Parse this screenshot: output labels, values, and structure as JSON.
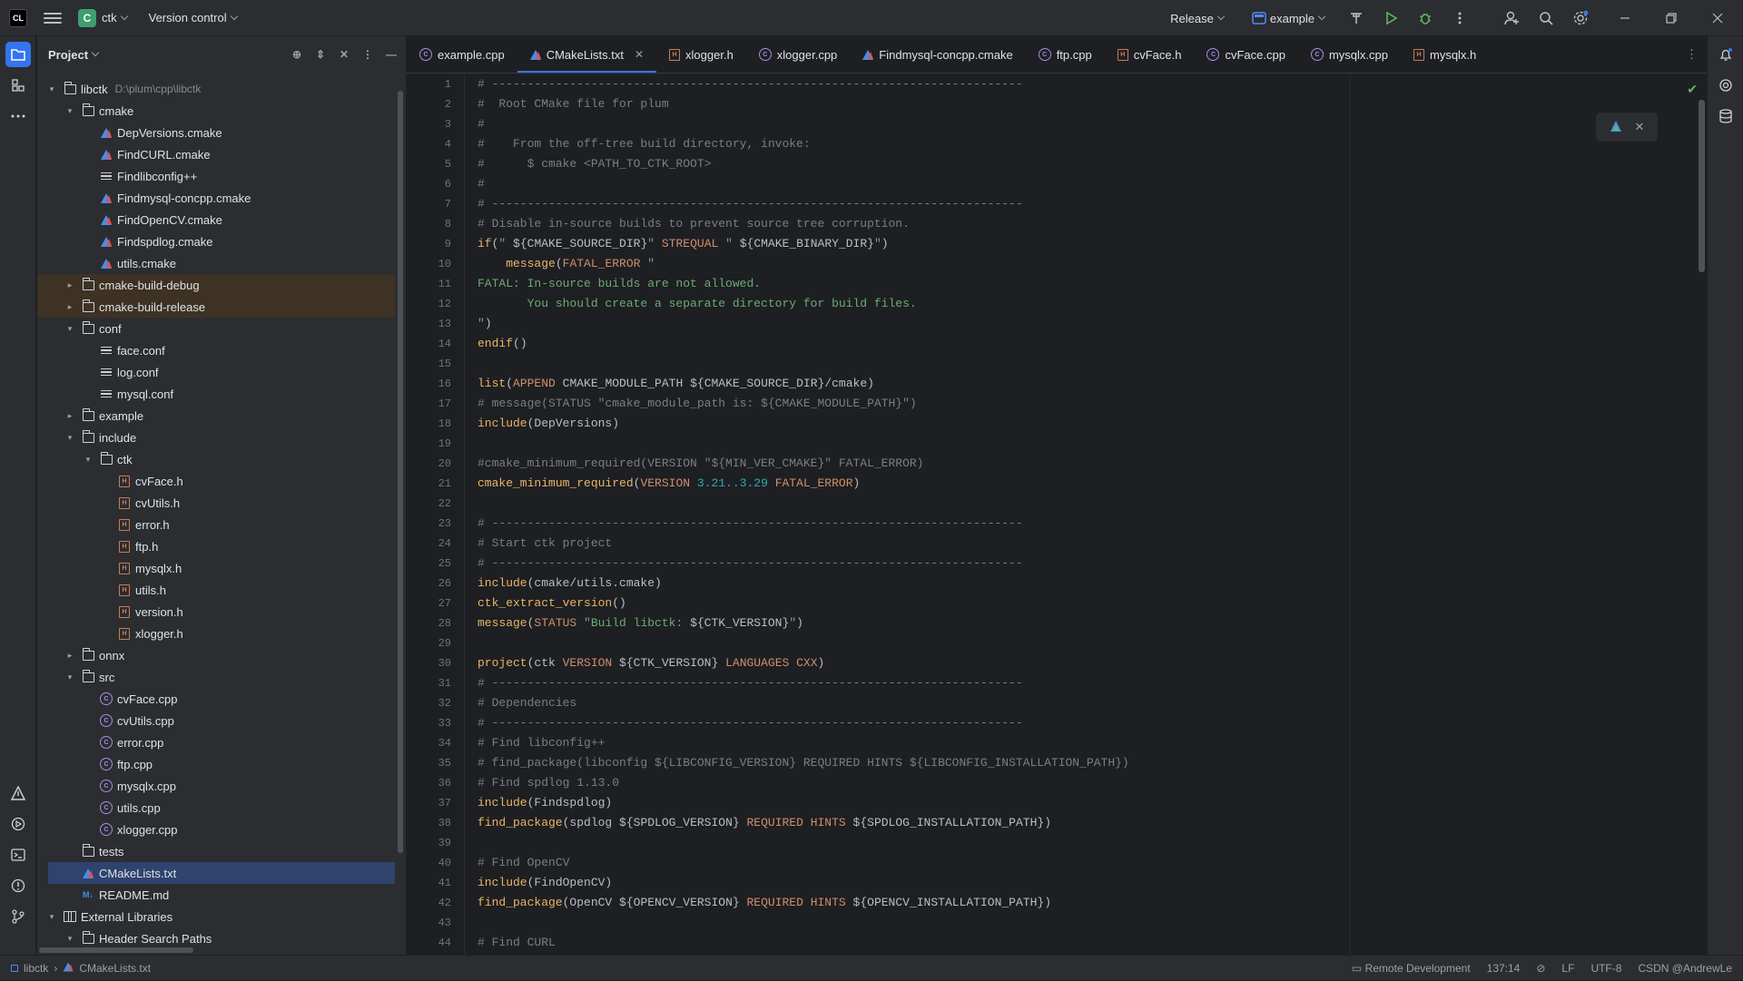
{
  "titlebar": {
    "logo_text": "CL",
    "project_badge": "C",
    "project_name": "ctk",
    "vcs_label": "Version control",
    "config_label": "Release",
    "run_target": "example"
  },
  "project_panel": {
    "title": "Project",
    "tree": [
      {
        "depth": 0,
        "expanded": true,
        "icon": "folder",
        "label": "libctk",
        "path": "D:\\plum\\cpp\\libctk"
      },
      {
        "depth": 1,
        "expanded": true,
        "icon": "folder",
        "label": "cmake"
      },
      {
        "depth": 2,
        "icon": "cmake",
        "label": "DepVersions.cmake"
      },
      {
        "depth": 2,
        "icon": "cmake",
        "label": "FindCURL.cmake"
      },
      {
        "depth": 2,
        "icon": "text",
        "label": "Findlibconfig++"
      },
      {
        "depth": 2,
        "icon": "cmake",
        "label": "Findmysql-concpp.cmake"
      },
      {
        "depth": 2,
        "icon": "cmake",
        "label": "FindOpenCV.cmake"
      },
      {
        "depth": 2,
        "icon": "cmake",
        "label": "Findspdlog.cmake"
      },
      {
        "depth": 2,
        "icon": "cmake",
        "label": "utils.cmake"
      },
      {
        "depth": 1,
        "expanded": false,
        "icon": "folder",
        "label": "cmake-build-debug",
        "highlight": true
      },
      {
        "depth": 1,
        "expanded": false,
        "icon": "folder",
        "label": "cmake-build-release",
        "highlight": true
      },
      {
        "depth": 1,
        "expanded": true,
        "icon": "folder",
        "label": "conf"
      },
      {
        "depth": 2,
        "icon": "text",
        "label": "face.conf"
      },
      {
        "depth": 2,
        "icon": "text",
        "label": "log.conf"
      },
      {
        "depth": 2,
        "icon": "text",
        "label": "mysql.conf"
      },
      {
        "depth": 1,
        "expanded": false,
        "icon": "folder",
        "label": "example"
      },
      {
        "depth": 1,
        "expanded": true,
        "icon": "folder",
        "label": "include"
      },
      {
        "depth": 2,
        "expanded": true,
        "icon": "folder",
        "label": "ctk"
      },
      {
        "depth": 3,
        "icon": "header",
        "label": "cvFace.h"
      },
      {
        "depth": 3,
        "icon": "header",
        "label": "cvUtils.h"
      },
      {
        "depth": 3,
        "icon": "header",
        "label": "error.h"
      },
      {
        "depth": 3,
        "icon": "header",
        "label": "ftp.h"
      },
      {
        "depth": 3,
        "icon": "header",
        "label": "mysqlx.h"
      },
      {
        "depth": 3,
        "icon": "header",
        "label": "utils.h"
      },
      {
        "depth": 3,
        "icon": "header",
        "label": "version.h"
      },
      {
        "depth": 3,
        "icon": "header",
        "label": "xlogger.h"
      },
      {
        "depth": 1,
        "expanded": false,
        "icon": "folder",
        "label": "onnx"
      },
      {
        "depth": 1,
        "expanded": true,
        "icon": "folder",
        "label": "src"
      },
      {
        "depth": 2,
        "icon": "cpp",
        "label": "cvFace.cpp"
      },
      {
        "depth": 2,
        "icon": "cpp",
        "label": "cvUtils.cpp"
      },
      {
        "depth": 2,
        "icon": "cpp",
        "label": "error.cpp"
      },
      {
        "depth": 2,
        "icon": "cpp",
        "label": "ftp.cpp"
      },
      {
        "depth": 2,
        "icon": "cpp",
        "label": "mysqlx.cpp"
      },
      {
        "depth": 2,
        "icon": "cpp",
        "label": "utils.cpp"
      },
      {
        "depth": 2,
        "icon": "cpp",
        "label": "xlogger.cpp"
      },
      {
        "depth": 1,
        "icon": "folder",
        "label": "tests",
        "leaf": true
      },
      {
        "depth": 1,
        "icon": "cmake",
        "label": "CMakeLists.txt",
        "selected": true
      },
      {
        "depth": 1,
        "icon": "markdown",
        "label": "README.md"
      },
      {
        "depth": 0,
        "expanded": true,
        "icon": "library",
        "label": "External Libraries"
      },
      {
        "depth": 1,
        "expanded": true,
        "icon": "folder",
        "label": "Header Search Paths"
      }
    ]
  },
  "tabs": [
    {
      "label": "example.cpp",
      "icon": "cpp"
    },
    {
      "label": "CMakeLists.txt",
      "icon": "cmake",
      "active": true
    },
    {
      "label": "xlogger.h",
      "icon": "header"
    },
    {
      "label": "xlogger.cpp",
      "icon": "cpp"
    },
    {
      "label": "Findmysql-concpp.cmake",
      "icon": "cmake"
    },
    {
      "label": "ftp.cpp",
      "icon": "cpp"
    },
    {
      "label": "cvFace.h",
      "icon": "header"
    },
    {
      "label": "cvFace.cpp",
      "icon": "cpp"
    },
    {
      "label": "mysqlx.cpp",
      "icon": "cpp"
    },
    {
      "label": "mysqlx.h",
      "icon": "header"
    }
  ],
  "editor": {
    "lines": [
      [
        [
          "c",
          "# ---------------------------------------------------------------------------"
        ]
      ],
      [
        [
          "c",
          "#  Root CMake file for plum"
        ]
      ],
      [
        [
          "c",
          "#"
        ]
      ],
      [
        [
          "c",
          "#    From the off-tree build directory, invoke:"
        ]
      ],
      [
        [
          "c",
          "#      $ cmake <PATH_TO_CTK_ROOT>"
        ]
      ],
      [
        [
          "c",
          "#"
        ]
      ],
      [
        [
          "c",
          "# ---------------------------------------------------------------------------"
        ]
      ],
      [
        [
          "c",
          "# Disable in-source builds to prevent source tree corruption."
        ]
      ],
      [
        [
          "f",
          "if"
        ],
        [
          "p",
          "("
        ],
        [
          "s",
          "\" "
        ],
        [
          "p",
          "${"
        ],
        [
          "p",
          "CMAKE_SOURCE_DIR"
        ],
        [
          "p",
          "}"
        ],
        [
          "s",
          "\" "
        ],
        [
          "k",
          "STREQUAL"
        ],
        [
          "s",
          " \" "
        ],
        [
          "p",
          "${"
        ],
        [
          "p",
          "CMAKE_BINARY_DIR"
        ],
        [
          "p",
          "}"
        ],
        [
          "s",
          "\""
        ],
        [
          "p",
          ")"
        ]
      ],
      [
        [
          "p",
          "    "
        ],
        [
          "f",
          "message"
        ],
        [
          "p",
          "("
        ],
        [
          "k",
          "FATAL_ERROR"
        ],
        [
          "s",
          " \""
        ]
      ],
      [
        [
          "s",
          "FATAL: In-source builds are not allowed."
        ]
      ],
      [
        [
          "s",
          "       You should create a separate directory for build files."
        ]
      ],
      [
        [
          "s",
          "\""
        ],
        [
          "p",
          ")"
        ]
      ],
      [
        [
          "f",
          "endif"
        ],
        [
          "p",
          "()"
        ]
      ],
      [
        [
          "p",
          ""
        ]
      ],
      [
        [
          "f",
          "list"
        ],
        [
          "p",
          "("
        ],
        [
          "k",
          "APPEND"
        ],
        [
          "p",
          " CMAKE_MODULE_PATH "
        ],
        [
          "p",
          "${"
        ],
        [
          "p",
          "CMAKE_SOURCE_DIR"
        ],
        [
          "p",
          "}"
        ],
        [
          "p",
          "/cmake)"
        ]
      ],
      [
        [
          "c",
          "# message(STATUS \"cmake_module_path is: ${CMAKE_MODULE_PATH}\")"
        ]
      ],
      [
        [
          "f",
          "include"
        ],
        [
          "p",
          "(DepVersions)"
        ]
      ],
      [
        [
          "p",
          ""
        ]
      ],
      [
        [
          "c",
          "#cmake_minimum_required(VERSION \"${MIN_VER_CMAKE}\" FATAL_ERROR)"
        ]
      ],
      [
        [
          "f",
          "cmake_minimum_required"
        ],
        [
          "p",
          "("
        ],
        [
          "k",
          "VERSION"
        ],
        [
          "n",
          " 3.21..3.29"
        ],
        [
          "k",
          " FATAL_ERROR"
        ],
        [
          "p",
          ")"
        ]
      ],
      [
        [
          "p",
          ""
        ]
      ],
      [
        [
          "c",
          "# ---------------------------------------------------------------------------"
        ]
      ],
      [
        [
          "c",
          "# Start ctk project"
        ]
      ],
      [
        [
          "c",
          "# ---------------------------------------------------------------------------"
        ]
      ],
      [
        [
          "f",
          "include"
        ],
        [
          "p",
          "(cmake/utils.cmake)"
        ]
      ],
      [
        [
          "f",
          "ctk_extract_version"
        ],
        [
          "p",
          "()"
        ]
      ],
      [
        [
          "f",
          "message"
        ],
        [
          "p",
          "("
        ],
        [
          "k",
          "STATUS"
        ],
        [
          "s",
          " \"Build libctk: "
        ],
        [
          "p",
          "${"
        ],
        [
          "p",
          "CTK_VERSION"
        ],
        [
          "p",
          "}"
        ],
        [
          "s",
          "\""
        ],
        [
          "p",
          ")"
        ]
      ],
      [
        [
          "p",
          ""
        ]
      ],
      [
        [
          "f",
          "project"
        ],
        [
          "p",
          "(ctk "
        ],
        [
          "k",
          "VERSION"
        ],
        [
          "p",
          " "
        ],
        [
          "p",
          "${"
        ],
        [
          "p",
          "CTK_VERSION"
        ],
        [
          "p",
          "}"
        ],
        [
          "k",
          " LANGUAGES"
        ],
        [
          "k",
          " CXX"
        ],
        [
          "p",
          ")"
        ]
      ],
      [
        [
          "c",
          "# ---------------------------------------------------------------------------"
        ]
      ],
      [
        [
          "c",
          "# Dependencies"
        ]
      ],
      [
        [
          "c",
          "# ---------------------------------------------------------------------------"
        ]
      ],
      [
        [
          "c",
          "# Find libconfig++"
        ]
      ],
      [
        [
          "c",
          "# find_package(libconfig ${LIBCONFIG_VERSION} REQUIRED HINTS ${LIBCONFIG_INSTALLATION_PATH})"
        ]
      ],
      [
        [
          "c",
          "# Find spdlog 1.13.0"
        ]
      ],
      [
        [
          "f",
          "include"
        ],
        [
          "p",
          "(Findspdlog)"
        ]
      ],
      [
        [
          "f",
          "find_package"
        ],
        [
          "p",
          "(spdlog "
        ],
        [
          "p",
          "${"
        ],
        [
          "p",
          "SPDLOG_VERSION"
        ],
        [
          "p",
          "}"
        ],
        [
          "k",
          " REQUIRED"
        ],
        [
          "k",
          " HINTS"
        ],
        [
          "p",
          " "
        ],
        [
          "p",
          "${"
        ],
        [
          "p",
          "SPDLOG_INSTALLATION_PATH"
        ],
        [
          "p",
          "}"
        ],
        [
          "p",
          ")"
        ]
      ],
      [
        [
          "p",
          ""
        ]
      ],
      [
        [
          "c",
          "# Find OpenCV"
        ]
      ],
      [
        [
          "f",
          "include"
        ],
        [
          "p",
          "(FindOpenCV)"
        ]
      ],
      [
        [
          "f",
          "find_package"
        ],
        [
          "p",
          "(OpenCV "
        ],
        [
          "p",
          "${"
        ],
        [
          "p",
          "OPENCV_VERSION"
        ],
        [
          "p",
          "}"
        ],
        [
          "k",
          " REQUIRED"
        ],
        [
          "k",
          " HINTS"
        ],
        [
          "p",
          " "
        ],
        [
          "p",
          "${"
        ],
        [
          "p",
          "OPENCV_INSTALLATION_PATH"
        ],
        [
          "p",
          "}"
        ],
        [
          "p",
          ")"
        ]
      ],
      [
        [
          "p",
          ""
        ]
      ],
      [
        [
          "c",
          "# Find CURL"
        ]
      ]
    ]
  },
  "statusbar": {
    "crumb_root": "libctk",
    "crumb_file": "CMakeLists.txt",
    "remote": "Remote Development",
    "position": "137:14",
    "line_sep": "LF",
    "encoding": "UTF-8",
    "watermark": "CSDN @AndrewLe"
  },
  "colors": {
    "accent": "#3574f0",
    "comment": "#7a7e85",
    "function": "#e8b666",
    "keyword": "#cf8e6d",
    "string": "#6aab73",
    "number": "#2aacb8"
  }
}
